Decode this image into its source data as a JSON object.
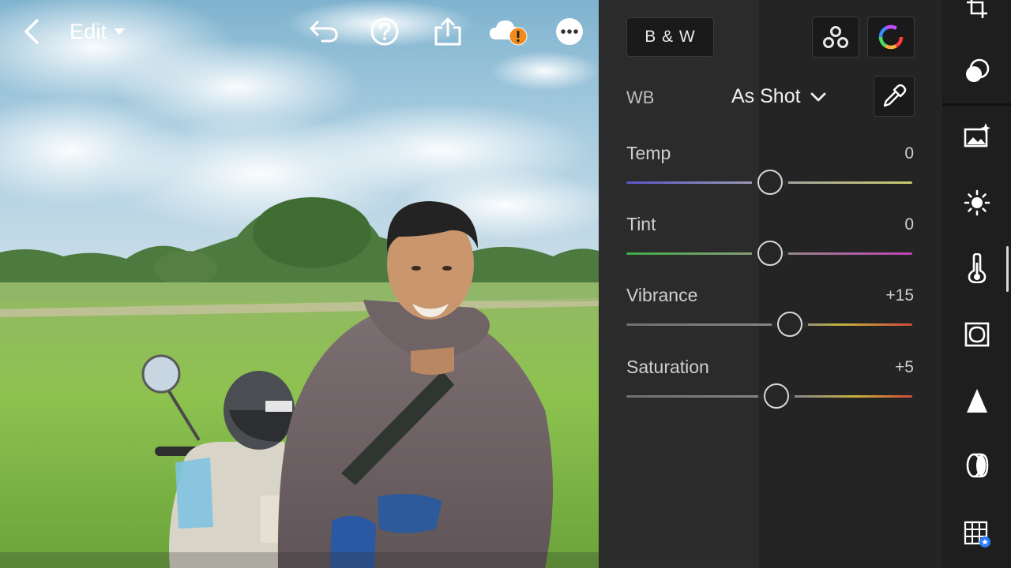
{
  "topbar": {
    "edit_label": "Edit"
  },
  "panel": {
    "bw_label": "B & W",
    "wb_label": "WB",
    "wb_value": "As Shot",
    "sliders": [
      {
        "label": "Temp",
        "value": "0"
      },
      {
        "label": "Tint",
        "value": "0"
      },
      {
        "label": "Vibrance",
        "value": "+15"
      },
      {
        "label": "Saturation",
        "value": "+5"
      }
    ]
  },
  "rail": {
    "tools": [
      "crop-icon",
      "masking-icon",
      "presets-icon",
      "light-icon",
      "color-temperature-icon",
      "effects-icon",
      "detail-icon",
      "optics-icon",
      "geometry-icon"
    ]
  },
  "colors": {
    "panel_bg": "#2b2b2b",
    "rail_bg": "#1e1e1e",
    "cloud_warning": "#f08a1c"
  }
}
